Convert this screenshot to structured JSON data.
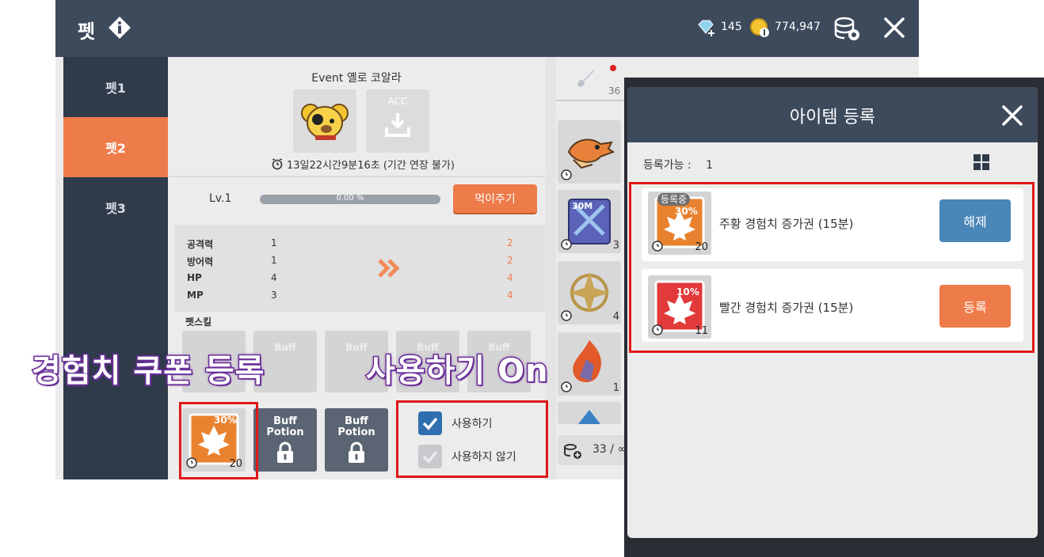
{
  "header": {
    "title": "펫",
    "crystal_count": "145",
    "meso_count": "774,947"
  },
  "sidebar": {
    "tabs": [
      {
        "label": "펫1"
      },
      {
        "label": "펫2"
      },
      {
        "label": "펫3"
      }
    ],
    "active_index": 1
  },
  "pet": {
    "name": "Event 옐로 코알라",
    "acc_label": "ACC",
    "timer": "13일22시간9분16초 (기간 연장 불가)",
    "level": "Lv.1",
    "exp_percent_text": "0.00 %",
    "exp_fraction": 0.0,
    "feed_label": "먹이주기",
    "stats": [
      {
        "name": "공격력",
        "current": "1",
        "next": "2"
      },
      {
        "name": "방어력",
        "current": "1",
        "next": "2"
      },
      {
        "name": "HP",
        "current": "4",
        "next": "4"
      },
      {
        "name": "MP",
        "current": "3",
        "next": "4"
      }
    ],
    "skill_title": "펫스킬",
    "skill_ghost_label": "Buff",
    "potion_label_line1": "Buff",
    "potion_label_line2": "Potion",
    "coupon_percent": "30%",
    "coupon_count": "20",
    "use_label": "사용하기",
    "not_use_label": "사용하지 않기"
  },
  "inventory": {
    "first_tab_count": "36",
    "slot_counts": [
      "",
      "3",
      "4",
      "1"
    ],
    "slot_badge_30m": "30M",
    "bottom_count": "33 / ∞"
  },
  "annotations": {
    "left_caption": "경험치 쿠폰 등록",
    "right_caption": "사용하기 On"
  },
  "modal": {
    "title": "아이템 등록",
    "register_available_label": "등록가능 :",
    "register_available_value": "1",
    "items": [
      {
        "badge": "등록중",
        "percent": "30%",
        "count": "20",
        "name": "주황 경험치 증가권 (15분)",
        "button": "해제"
      },
      {
        "badge": "",
        "percent": "10%",
        "count": "11",
        "name": "빨간 경험치 증가권 (15분)",
        "button": "등록"
      }
    ]
  },
  "colors": {
    "header_bg": "#3d4a5c",
    "accent_orange": "#ee7b4a",
    "release_blue": "#4a86b8",
    "highlight_red": "#e01818",
    "caption_purple": "#6b2f9a"
  }
}
